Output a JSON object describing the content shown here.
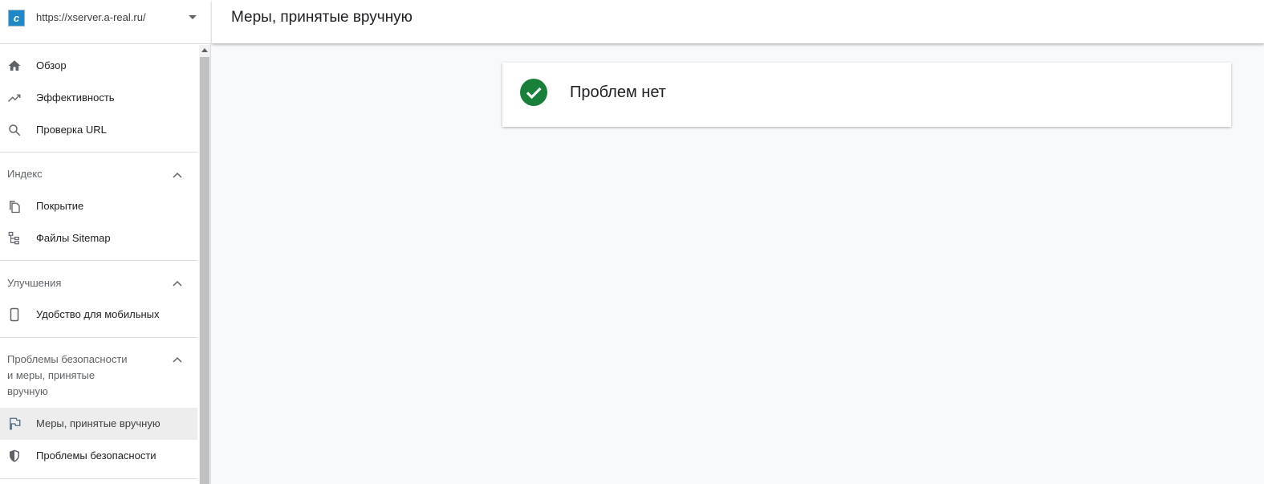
{
  "property": {
    "url": "https://xserver.a-real.ru/",
    "logo_glyph": "c"
  },
  "header": {
    "title": "Меры, принятые вручную"
  },
  "sidebar": {
    "top_items": [
      {
        "label": "Обзор",
        "icon": "home-icon"
      },
      {
        "label": "Эффективность",
        "icon": "trending-up-icon"
      },
      {
        "label": "Проверка URL",
        "icon": "search-icon"
      }
    ],
    "sections": [
      {
        "title": "Индекс",
        "items": [
          {
            "label": "Покрытие",
            "icon": "pages-icon"
          },
          {
            "label": "Файлы Sitemap",
            "icon": "sitemap-icon"
          }
        ]
      },
      {
        "title": "Улучшения",
        "items": [
          {
            "label": "Удобство для мобильных",
            "icon": "smartphone-icon"
          }
        ]
      },
      {
        "title_lines": [
          "Проблемы безопасности",
          "и меры, принятые",
          "вручную"
        ],
        "items": [
          {
            "label": "Меры, принятые вручную",
            "icon": "flag-icon",
            "active": true
          },
          {
            "label": "Проблемы безопасности",
            "icon": "shield-icon"
          }
        ]
      }
    ]
  },
  "status_card": {
    "text": "Проблем нет",
    "status_color": "#188038"
  }
}
